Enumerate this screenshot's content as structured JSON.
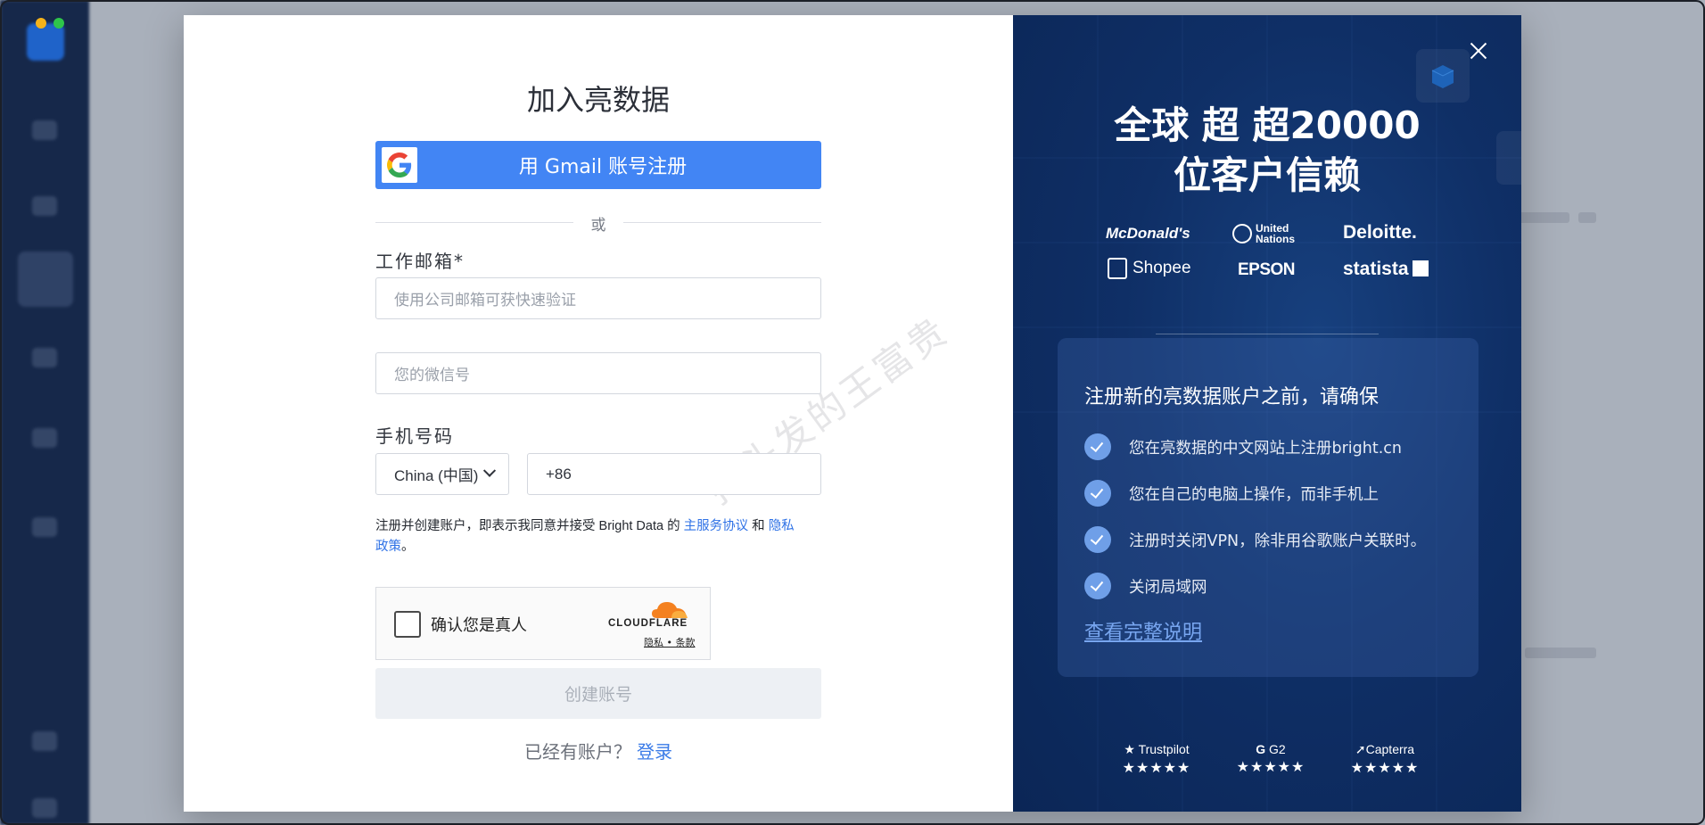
{
  "modal": {
    "title": "加入亮数据",
    "gmail_button": "用 Gmail 账号注册",
    "divider_text": "或",
    "email_label": "工作邮箱*",
    "email_placeholder": "使用公司邮箱可获快速验证",
    "wechat_placeholder": "您的微信号",
    "phone_label": "手机号码",
    "country_select": "China (中国)",
    "phone_prefix": "+86",
    "terms_text": "注册并创建账户，即表示我同意并接受 Bright Data 的",
    "terms_link1": "主服务协议",
    "terms_and": "和",
    "terms_link2a": "隐私",
    "terms_link2b": "政策",
    "terms_end": "。",
    "captcha_label": "确认您是真人",
    "captcha_brand": "CLOUDFLARE",
    "captcha_links": "隐私 • 条款",
    "create_button": "创建账号",
    "login_prompt": "已经有账户？",
    "login_link": "登录",
    "watermark": "掉头发的王富贵"
  },
  "promo": {
    "headline_line1": "全球 超 超20000",
    "headline_line2": "位客户信赖",
    "logos": [
      "McDonald's",
      "United Nations",
      "Deloitte.",
      "Shopee",
      "EPSON",
      "statista"
    ],
    "card_title": "注册新的亮数据账户之前，请确保",
    "checklist": [
      "您在亮数据的中文网站上注册bright.cn",
      "您在自己的电脑上操作，而非手机上",
      "注册时关闭VPN，除非用谷歌账户关联时。",
      "关闭局域网"
    ],
    "card_link": "查看完整说明",
    "ratings": [
      {
        "name": "★ Trustpilot",
        "stars": "★★★★★"
      },
      {
        "name": "G2",
        "stars": "★★★★★"
      },
      {
        "name": "Capterra",
        "stars": "★★★★★"
      }
    ]
  },
  "colors": {
    "accent": "#4285f4",
    "panel_bg": "#0f2f66",
    "link": "#2f72e6"
  }
}
